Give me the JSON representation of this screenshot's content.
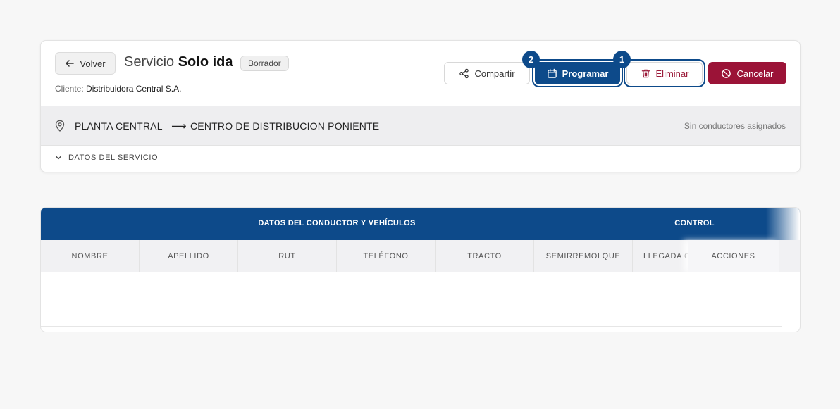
{
  "header": {
    "back_label": "Volver",
    "title_prefix": "Servicio",
    "title_main": "Solo ida",
    "status_badge": "Borrador",
    "client_label": "Cliente:",
    "client_name": "Distribuidora Central S.A."
  },
  "actions": {
    "share_label": "Compartir",
    "schedule_label": "Programar",
    "delete_label": "Eliminar",
    "cancel_label": "Cancelar",
    "schedule_step": "2",
    "delete_step": "1"
  },
  "route": {
    "origin": "PLANTA CENTRAL",
    "arrow": "⟶",
    "destination": "CENTRO DE DISTRIBUCION PONIENTE",
    "drivers_status": "Sin conductores asignados"
  },
  "details": {
    "toggle_label": "DATOS DEL SERVICIO"
  },
  "table": {
    "groups": [
      "DATOS DEL CONDUCTOR Y VEHÍCULOS",
      "CONTROL"
    ],
    "columns": [
      "NOMBRE",
      "APELLIDO",
      "RUT",
      "TELÉFONO",
      "TRACTO",
      "SEMIRREMOLQUE",
      "LLEGADA C"
    ],
    "actions_column": "ACCIONES",
    "rows": []
  },
  "colors": {
    "primary": "#0d4a8a",
    "danger": "#9b1337",
    "background": "#f7f7f7"
  }
}
